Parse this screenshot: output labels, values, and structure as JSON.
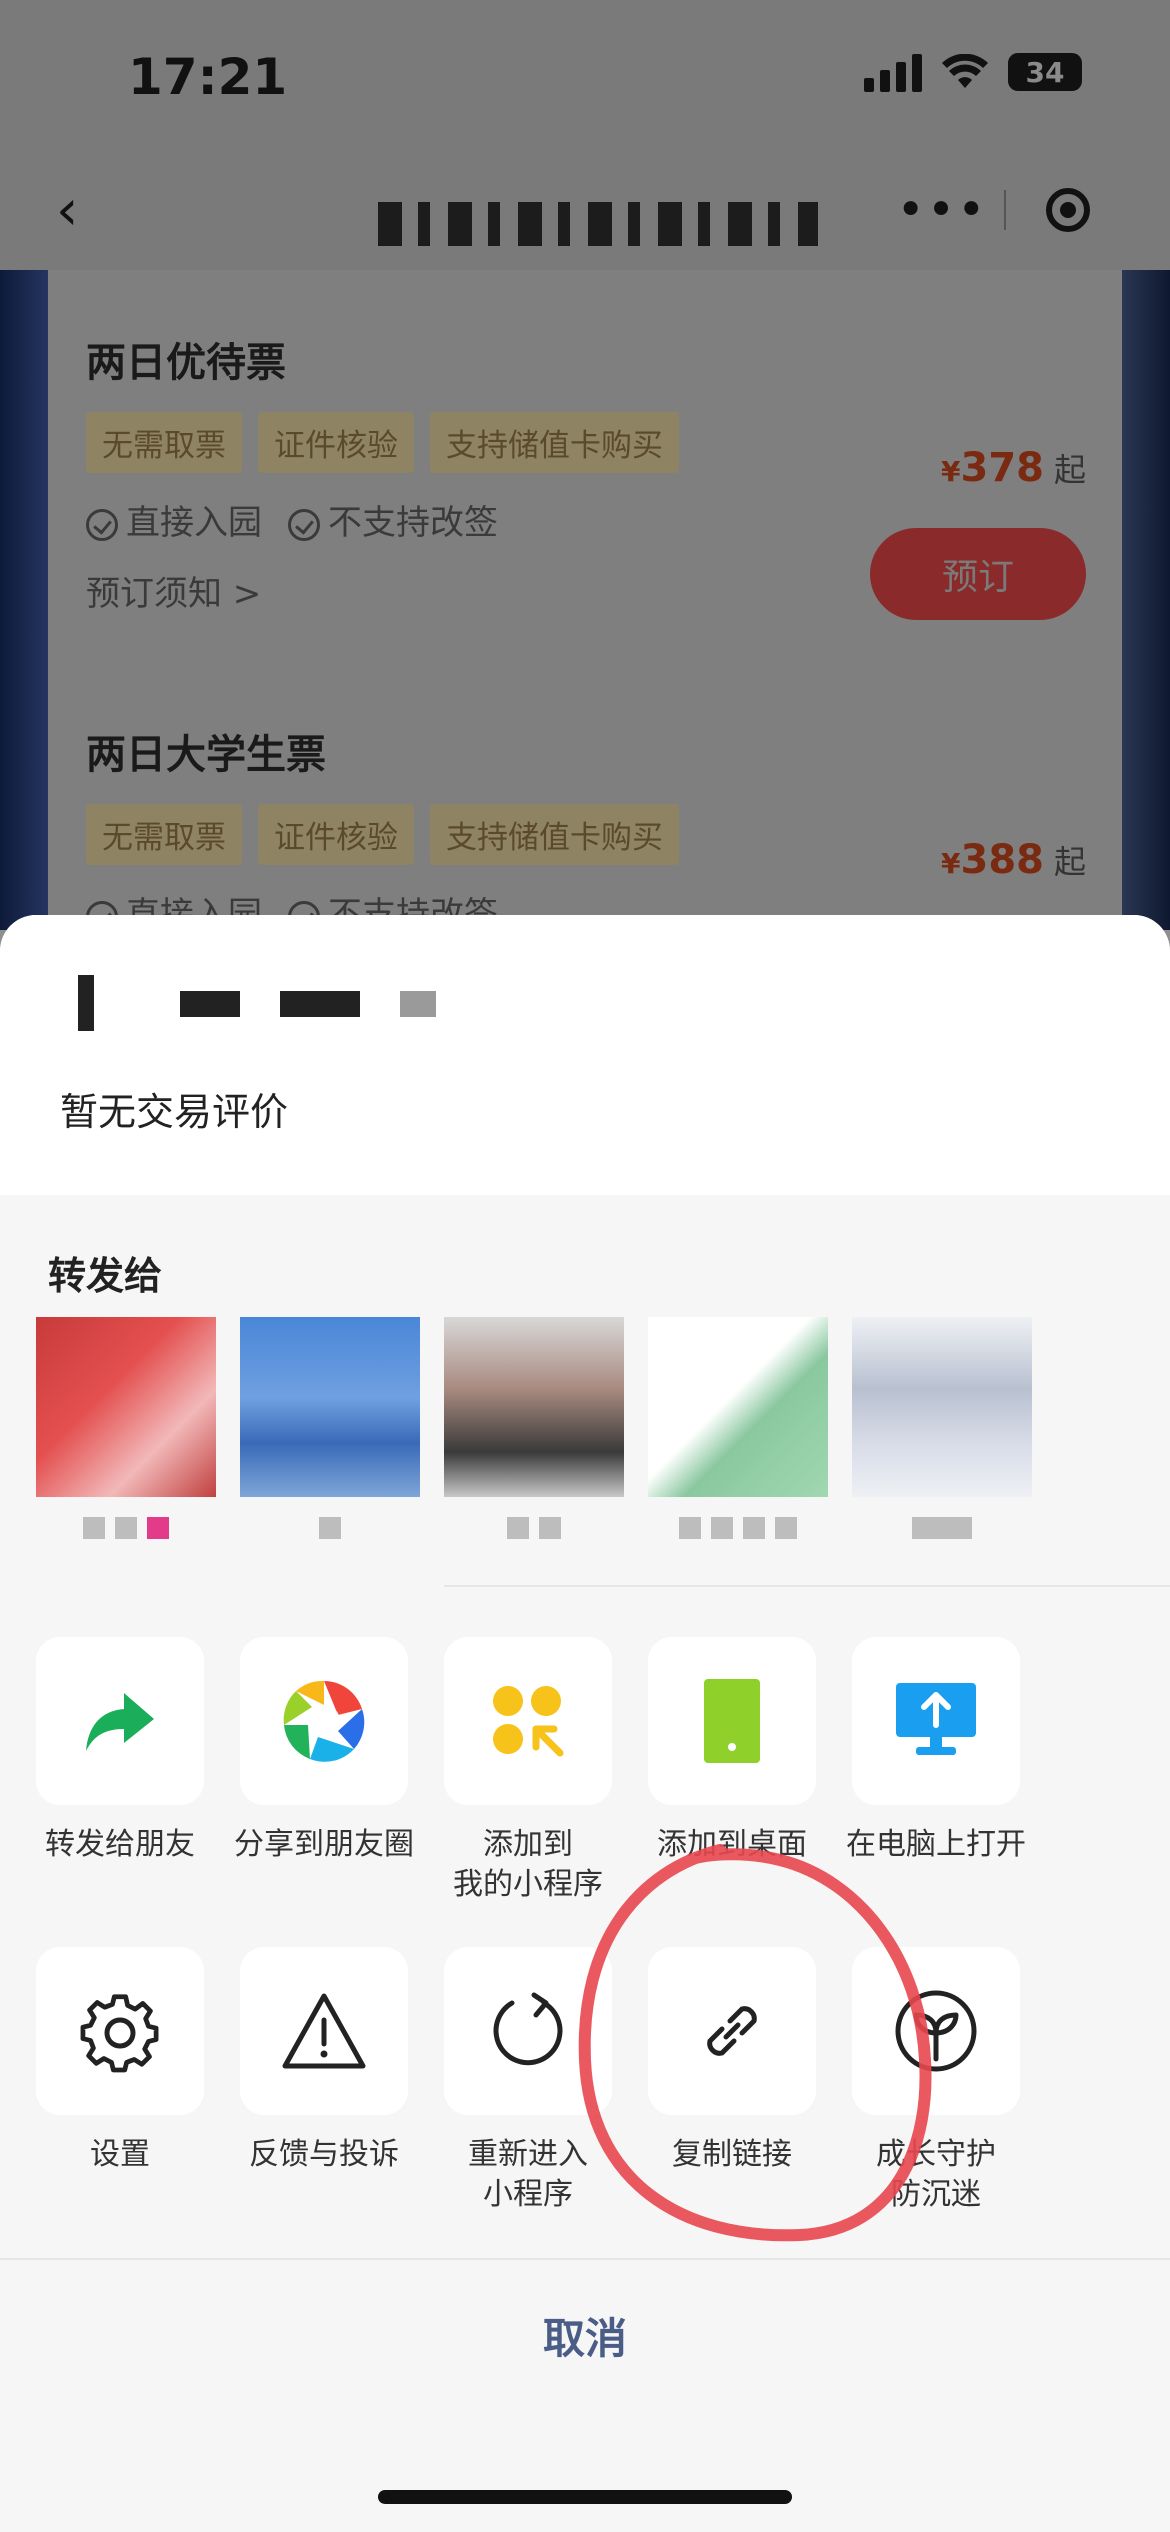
{
  "status_bar": {
    "time": "17:21",
    "battery": "34"
  },
  "nav": {
    "back_icon": "chevron-left-icon",
    "more_icon": "more-dots-icon",
    "close_icon": "target-icon"
  },
  "tickets": [
    {
      "title": "两日优待票",
      "tags": [
        "无需取票",
        "证件核验",
        "支持储值卡购买"
      ],
      "checks": [
        "直接入园",
        "不支持改签"
      ],
      "notice": "预订须知 >",
      "price": "378",
      "price_prefix": "¥",
      "price_suffix": "起",
      "book_label": "预订"
    },
    {
      "title": "两日大学生票",
      "tags": [
        "无需取票",
        "证件核验",
        "支持储值卡购买"
      ],
      "checks": [
        "直接入园",
        "不支持改签"
      ],
      "price": "388",
      "price_prefix": "¥",
      "price_suffix": "起"
    }
  ],
  "sheet": {
    "no_review": "暂无交易评价",
    "share_label": "转发给",
    "row1": [
      {
        "label": "转发给朋友",
        "icon": "forward-arrow-icon"
      },
      {
        "label": "分享到朋友圈",
        "icon": "moments-aperture-icon"
      },
      {
        "label": "添加到\n我的小程序",
        "icon": "add-miniprogram-icon"
      },
      {
        "label": "添加到桌面",
        "icon": "phone-desktop-icon"
      },
      {
        "label": "在电脑上打开",
        "icon": "monitor-upload-icon"
      }
    ],
    "row2": [
      {
        "label": "设置",
        "icon": "gear-icon"
      },
      {
        "label": "反馈与投诉",
        "icon": "warning-triangle-icon"
      },
      {
        "label": "重新进入\n小程序",
        "icon": "reload-icon"
      },
      {
        "label": "复制链接",
        "icon": "link-icon"
      },
      {
        "label": "成长守护\n防沉迷",
        "icon": "sprout-icon"
      }
    ],
    "cancel_label": "取消"
  },
  "colors": {
    "accent_link": "#4a5d86",
    "annotation_red": "#e8474f",
    "price_red": "#e04d1b"
  }
}
